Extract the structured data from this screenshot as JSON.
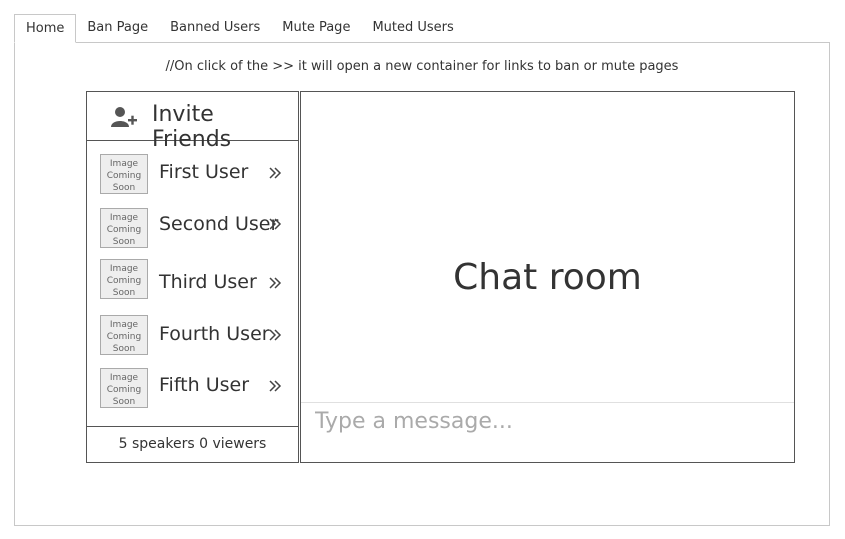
{
  "tabs": [
    {
      "label": "Home",
      "active": true
    },
    {
      "label": "Ban Page"
    },
    {
      "label": "Banned Users"
    },
    {
      "label": "Mute Page"
    },
    {
      "label": "Muted Users"
    }
  ],
  "note": "//On click of the >> it will open a new container for links to ban or mute pages",
  "sidebar": {
    "invite_label": "Invite Friends",
    "invite_icon": "add-user-icon",
    "users": [
      {
        "name": "First User",
        "avatar_text": [
          "Image",
          "Coming",
          "Soon"
        ]
      },
      {
        "name": "Second User",
        "avatar_text": [
          "Image",
          "Coming",
          "Soon"
        ]
      },
      {
        "name": "Third User",
        "avatar_text": [
          "Image",
          "Coming",
          "Soon"
        ]
      },
      {
        "name": "Fourth User",
        "avatar_text": [
          "Image",
          "Coming",
          "Soon"
        ]
      },
      {
        "name": "Fifth User",
        "avatar_text": [
          "Image",
          "Coming",
          "Soon"
        ]
      }
    ],
    "footer": "5 speakers 0 viewers"
  },
  "chat": {
    "title": "Chat room",
    "message_placeholder": "Type a message..."
  }
}
